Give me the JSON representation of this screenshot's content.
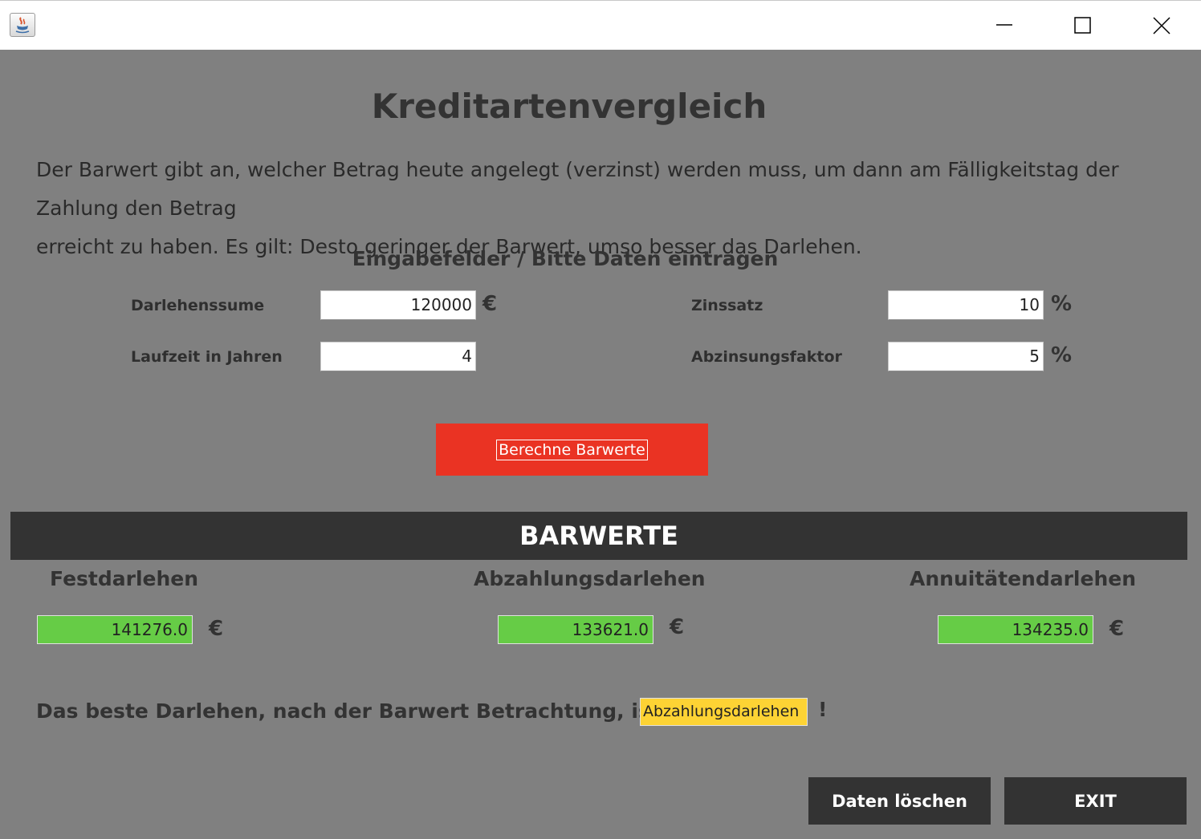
{
  "window": {
    "icon": "java-icon",
    "controls": [
      "minimize-icon",
      "maximize-icon",
      "close-icon"
    ]
  },
  "header": {
    "title": "Kreditartenvergleich",
    "intro_line1": "Der Barwert gibt an, welcher Betrag heute angelegt (verzinst) werden muss, um dann am Fälligkeitstag der Zahlung den Betrag",
    "intro_line2": "erreicht zu haben. Es gilt: Desto geringer der Barwert, umso besser das Darlehen."
  },
  "inputs": {
    "heading": "Eingabefelder / Bitte Daten eintragen",
    "loan_amount": {
      "label": "Darlehenssume",
      "value": "120000",
      "unit": "€"
    },
    "term_years": {
      "label": "Laufzeit in Jahren",
      "value": "4"
    },
    "interest_rate": {
      "label": "Zinssatz",
      "value": "10",
      "unit": "%"
    },
    "discount_factor": {
      "label": "Abzinsungsfaktor",
      "value": "5",
      "unit": "%"
    }
  },
  "calculate_button": {
    "label": "Berechne Barwerte",
    "color": "#ea3323"
  },
  "results": {
    "heading": "BARWERTE",
    "currency": "€",
    "columns": [
      {
        "name": "Festdarlehen",
        "value": "141276.0"
      },
      {
        "name": "Abzahlungsdarlehen",
        "value": "133621.0"
      },
      {
        "name": "Annuitätendarlehen",
        "value": "134235.0"
      }
    ],
    "field_color": "#66cc46"
  },
  "best": {
    "text": "Das beste Darlehen, nach der Barwert Betrachtung, ist das",
    "value": "Abzahlungsdarlehen",
    "suffix": "!",
    "field_color": "#fdd334"
  },
  "footer": {
    "clear_label": "Daten löschen",
    "exit_label": "EXIT"
  }
}
